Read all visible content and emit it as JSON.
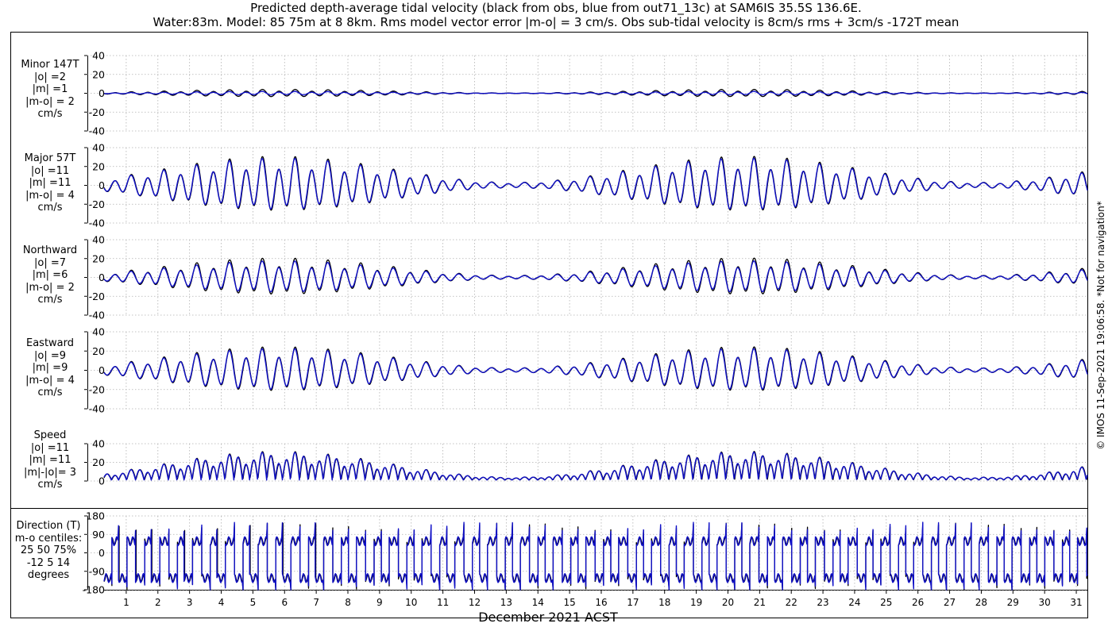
{
  "title": {
    "line1": "Predicted depth-average tidal velocity (black from obs, blue from out71_13c) at SAM6IS 35.5S 136.6E.",
    "line2": "Water:83m. Model: 85 75m at 8 8km. Rms model vector error |m-o| = 3 cm/s. Obs sub-tidal velocity is 8cm/s rms + 3cm/s -172T mean"
  },
  "watermark": "© IMOS 11-Sep-2021 19:06:58. *Not for navigation*",
  "colors": {
    "obs": "#000000",
    "model": "#1010c8",
    "grid": "#b0b0b0"
  },
  "chart_data": {
    "type": "line",
    "xlabel": "December 2021 ACST",
    "x_ticks": [
      "1",
      "2",
      "3",
      "4",
      "5",
      "6",
      "7",
      "8",
      "9",
      "10",
      "11",
      "12",
      "13",
      "14",
      "15",
      "16",
      "17",
      "18",
      "19",
      "20",
      "21",
      "22",
      "23",
      "24",
      "25",
      "26",
      "27",
      "28",
      "29",
      "30",
      "31"
    ],
    "xlim": [
      0.3,
      31.35
    ],
    "grid": true,
    "series_legend": {
      "black": "obs",
      "blue": "out71_13c"
    },
    "panels": [
      {
        "id": "minor",
        "label": [
          "Minor 147T",
          "|o| =2",
          "|m| =1",
          "|m-o| = 2",
          "cm/s"
        ],
        "ylim": [
          -40,
          40
        ],
        "y_ticks": [
          "40",
          "20",
          "0",
          "-20",
          "-40"
        ],
        "y_tick_values": [
          40,
          20,
          0,
          -20,
          -40
        ],
        "style": "wave",
        "obs_amplitude": 3.2,
        "model_amplitude": 1.6
      },
      {
        "id": "major",
        "label": [
          "Major 57T",
          "|o| =11",
          "|m| =11",
          "|m-o| = 4",
          "cm/s"
        ],
        "ylim": [
          -40,
          40
        ],
        "y_ticks": [
          "40",
          "20",
          "0",
          "-20",
          "-40"
        ],
        "y_tick_values": [
          40,
          20,
          0,
          -20,
          -40
        ],
        "style": "wave",
        "obs_amplitude": 24,
        "model_amplitude": 23
      },
      {
        "id": "north",
        "label": [
          "Northward",
          "|o| =7",
          "|m| =6",
          "|m-o| = 2",
          "cm/s"
        ],
        "ylim": [
          -40,
          40
        ],
        "y_ticks": [
          "40",
          "20",
          "0",
          "-20",
          "-40"
        ],
        "y_tick_values": [
          40,
          20,
          0,
          -20,
          -40
        ],
        "style": "wave",
        "obs_amplitude": 16,
        "model_amplitude": 14
      },
      {
        "id": "east",
        "label": [
          "Eastward",
          "|o| =9",
          "|m| =9",
          "|m-o| = 4",
          "cm/s"
        ],
        "ylim": [
          -40,
          40
        ],
        "y_ticks": [
          "40",
          "20",
          "0",
          "-20",
          "-40"
        ],
        "y_tick_values": [
          40,
          20,
          0,
          -20,
          -40
        ],
        "style": "wave",
        "obs_amplitude": 19,
        "model_amplitude": 18
      },
      {
        "id": "speed",
        "label": [
          "Speed",
          "|o| =11",
          "|m| =11",
          "|m|-|o|= 3",
          "cm/s"
        ],
        "ylim": [
          0,
          40
        ],
        "y_ticks": [
          "40",
          "20",
          "0"
        ],
        "y_tick_values": [
          40,
          20,
          0
        ],
        "style": "speed",
        "obs_amplitude": 24,
        "model_amplitude": 24
      },
      {
        "id": "direction",
        "label": [
          "Direction (T)",
          "m-o centiles:",
          "25  50  75%",
          "-12   5  14",
          "degrees"
        ],
        "ylim": [
          -180,
          180
        ],
        "y_ticks": [
          "180",
          "90",
          "0",
          "-90",
          "-180"
        ],
        "y_tick_values": [
          180,
          90,
          0,
          -90,
          -180
        ],
        "style": "direction",
        "major_dir_deg": 57,
        "minor_dir_deg": 147
      }
    ],
    "tide_model": {
      "cycles_per_day": 1.932,
      "spring_neap_period_days": 14.77,
      "spring_peak_days": [
        5.8,
        20.5
      ],
      "diurnal_fraction": 0.3
    }
  }
}
